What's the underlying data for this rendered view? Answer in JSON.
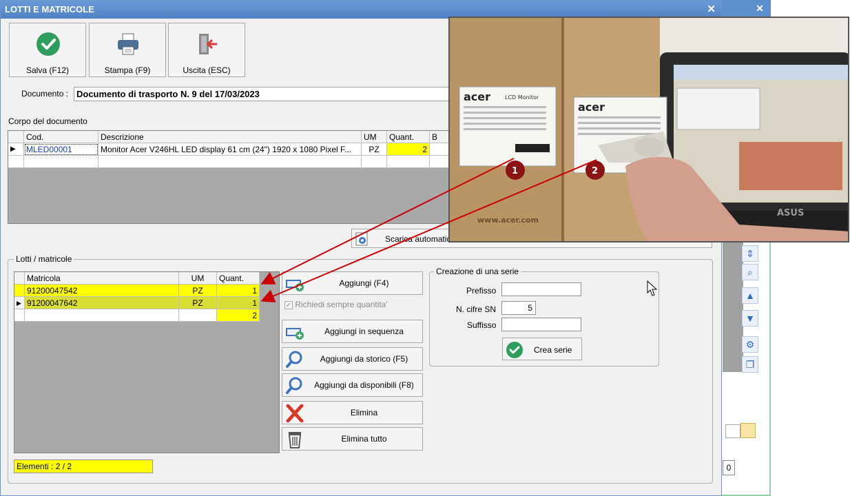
{
  "background_window": {
    "close_icon": "close-icon",
    "zero_value": "0"
  },
  "dialog": {
    "title": "LOTTI E MATRICOLE",
    "close_icon": "close-icon"
  },
  "toolbar": {
    "save_label": "Salva (F12)",
    "print_label": "Stampa (F9)",
    "exit_label": "Uscita (ESC)"
  },
  "document": {
    "label": "Documento :",
    "value": "Documento di trasporto N. 9 del 17/03/2023"
  },
  "body_grid": {
    "caption": "Corpo del documento",
    "headers": {
      "code": "Cod.",
      "description": "Descrizione",
      "um": "UM",
      "quantity": "Quant.",
      "extra": "B"
    },
    "rows": [
      {
        "code": "MLED00001",
        "description": "Monitor Acer V246HL LED display 61 cm (24\") 1920 x 1080 Pixel F...",
        "um": "PZ",
        "quantity": "2"
      }
    ]
  },
  "auto_download_label": "Scarica automatic",
  "lots": {
    "caption": "Lotti / matricole",
    "headers": {
      "serial": "Matricola",
      "um": "UM",
      "quantity": "Quant."
    },
    "rows": [
      {
        "serial": "91200047542",
        "um": "PZ",
        "quantity": "1"
      },
      {
        "serial": "91200047642",
        "um": "PZ",
        "quantity": "1"
      }
    ],
    "total_quantity": "2",
    "elements_label": "Elementi : 2 / 2"
  },
  "actions": {
    "add": "Aggiungi (F4)",
    "always_ask_quantity": "Richiedi sempre quantita'",
    "add_sequence": "Aggiungi in sequenza",
    "add_from_history": "Aggiungi da storico (F5)",
    "add_from_available": "Aggiungi da disponibili (F8)",
    "delete": "Elimina",
    "delete_all": "Elimina tutto"
  },
  "series": {
    "caption": "Creazione di una serie",
    "prefix_label": "Prefisso",
    "prefix_value": "",
    "digits_label": "N. cifre SN",
    "digits_value": "5",
    "suffix_label": "Suffisso",
    "suffix_value": "",
    "create_label": "Crea serie"
  },
  "photo": {
    "marker1": "1",
    "marker2": "2",
    "brand": "acer",
    "brand2": "acer",
    "label_title": "LCD Monitor",
    "url": "www.acer.com",
    "laptop_brand": "ASUS"
  },
  "colors": {
    "title_bar": "#5b8fce",
    "highlight_yellow": "#ffff00",
    "selected_row": "#d9de34",
    "arrow_red": "#cc0000"
  }
}
